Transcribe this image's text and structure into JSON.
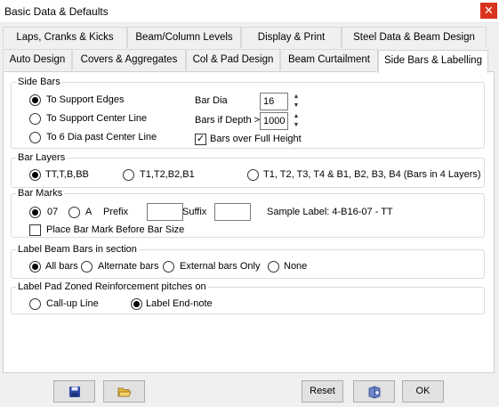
{
  "window": {
    "title": "Basic Data & Defaults",
    "close_glyph": "✕"
  },
  "tabs_row1": [
    {
      "label": "Laps, Cranks & Kicks"
    },
    {
      "label": "Beam/Column Levels"
    },
    {
      "label": "Display & Print"
    },
    {
      "label": "Steel Data & Beam Design"
    }
  ],
  "tabs_row2": [
    {
      "label": "Auto Design"
    },
    {
      "label": "Covers & Aggregates"
    },
    {
      "label": "Col & Pad Design"
    },
    {
      "label": "Beam Curtailment"
    },
    {
      "label": "Side Bars & Labelling",
      "active": true
    }
  ],
  "side_bars": {
    "title": "Side Bars",
    "options": [
      "To Support Edges",
      "To Support Center Line",
      "To 6 Dia past Center Line"
    ],
    "selected_index": 0,
    "bar_dia_label": "Bar Dia",
    "bar_dia_value": "16",
    "bars_if_depth_label": "Bars if Depth >",
    "bars_if_depth_value": "1000",
    "full_height_label": "Bars over Full Height",
    "full_height_checked": true
  },
  "bar_layers": {
    "title": "Bar Layers",
    "options": [
      "TT,T,B,BB",
      "T1,T2,B2,B1",
      "T1, T2, T3, T4 & B1, B2, B3, B4 (Bars in 4 Layers)"
    ],
    "selected_index": 0
  },
  "bar_marks": {
    "title": "Bar Marks",
    "options": [
      "07",
      "A"
    ],
    "selected_index": 0,
    "prefix_label": "Prefix",
    "prefix_value": "",
    "suffix_label": "Suffix",
    "suffix_value": "",
    "sample_label": "Sample Label: 4-B16-07 - TT",
    "place_before_label": "Place Bar Mark Before Bar Size",
    "place_before_checked": false
  },
  "label_beam_bars": {
    "title": "Label Beam Bars in section",
    "options": [
      "All bars",
      "Alternate bars",
      "External bars Only",
      "None"
    ],
    "selected_index": 0
  },
  "label_pad": {
    "title": "Label Pad Zoned Reinforcement pitches on",
    "options": [
      "Call-up Line",
      "Label End-note"
    ],
    "selected_index": 1
  },
  "footer": {
    "save_icon": "floppy-disk-icon",
    "open_icon": "open-folder-icon",
    "reset_label": "Reset",
    "help_icon": "help-book-icon",
    "ok_label": "OK"
  }
}
